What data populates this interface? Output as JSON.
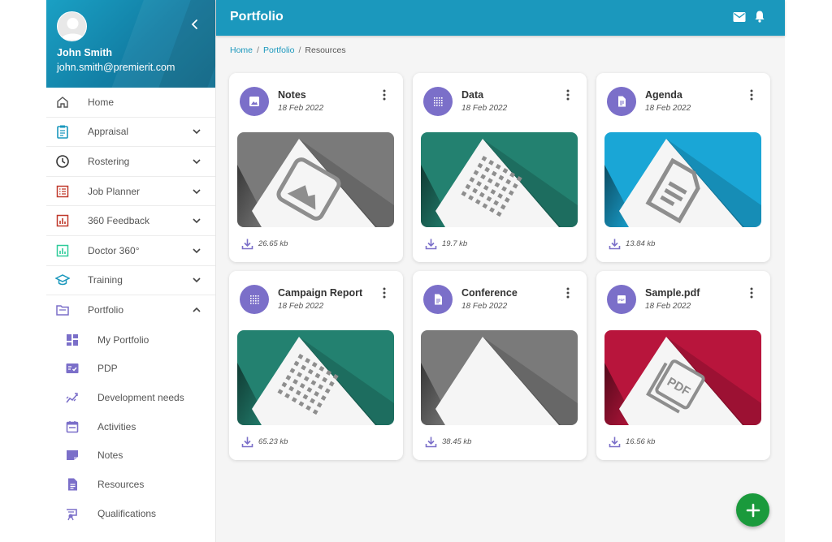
{
  "user": {
    "name": "John Smith",
    "email": "john.smith@premierit.com"
  },
  "nav": [
    {
      "label": "Home",
      "icon": "home-icon",
      "color": "#555555"
    },
    {
      "label": "Appraisal",
      "icon": "clipboard-icon",
      "color": "#1b98bd"
    },
    {
      "label": "Rostering",
      "icon": "clock-icon",
      "color": "#333333"
    },
    {
      "label": "Job Planner",
      "icon": "list-icon",
      "color": "#c0392b"
    },
    {
      "label": "360 Feedback",
      "icon": "bar-chart-icon",
      "color": "#c0392b"
    },
    {
      "label": "Doctor 360°",
      "icon": "bar-chart-icon",
      "color": "#2ecc9a"
    },
    {
      "label": "Training",
      "icon": "graduation-cap-icon",
      "color": "#1b98bd"
    },
    {
      "label": "Portfolio",
      "icon": "folder-icon",
      "color": "#7b6fc9"
    }
  ],
  "portfolio_sub": [
    {
      "label": "My Portfolio",
      "icon": "dashboard-icon"
    },
    {
      "label": "PDP",
      "icon": "checklist-icon"
    },
    {
      "label": "Development needs",
      "icon": "trend-icon"
    },
    {
      "label": "Activities",
      "icon": "calendar-icon"
    },
    {
      "label": "Notes",
      "icon": "note-icon"
    },
    {
      "label": "Resources",
      "icon": "document-icon"
    },
    {
      "label": "Qualifications",
      "icon": "certificate-icon"
    }
  ],
  "header": {
    "title": "Portfolio"
  },
  "breadcrumb": {
    "home": "Home",
    "portfolio": "Portfolio",
    "current": "Resources",
    "sep": "/"
  },
  "cards": [
    {
      "title": "Notes",
      "date": "18 Feb 2022",
      "size": "26.65 kb",
      "type": "image",
      "bg": "#7a7a7a"
    },
    {
      "title": "Data",
      "date": "18 Feb 2022",
      "size": "19.7 kb",
      "type": "grid",
      "bg": "#238170"
    },
    {
      "title": "Agenda",
      "date": "18 Feb 2022",
      "size": "13.84 kb",
      "type": "doc",
      "bg": "#1aa6d6"
    },
    {
      "title": "Campaign Report",
      "date": "18 Feb 2022",
      "size": "65.23 kb",
      "type": "grid",
      "bg": "#238170"
    },
    {
      "title": "Conference",
      "date": "18 Feb 2022",
      "size": "38.45 kb",
      "type": "blank",
      "bg": "#7a7a7a"
    },
    {
      "title": "Sample.pdf",
      "date": "18 Feb 2022",
      "size": "16.56 kb",
      "type": "pdf",
      "bg": "#b8153c"
    }
  ],
  "colors": {
    "accent": "#1b98bd",
    "icon_circle": "#7b6fc9",
    "fab": "#1a9a3c"
  }
}
